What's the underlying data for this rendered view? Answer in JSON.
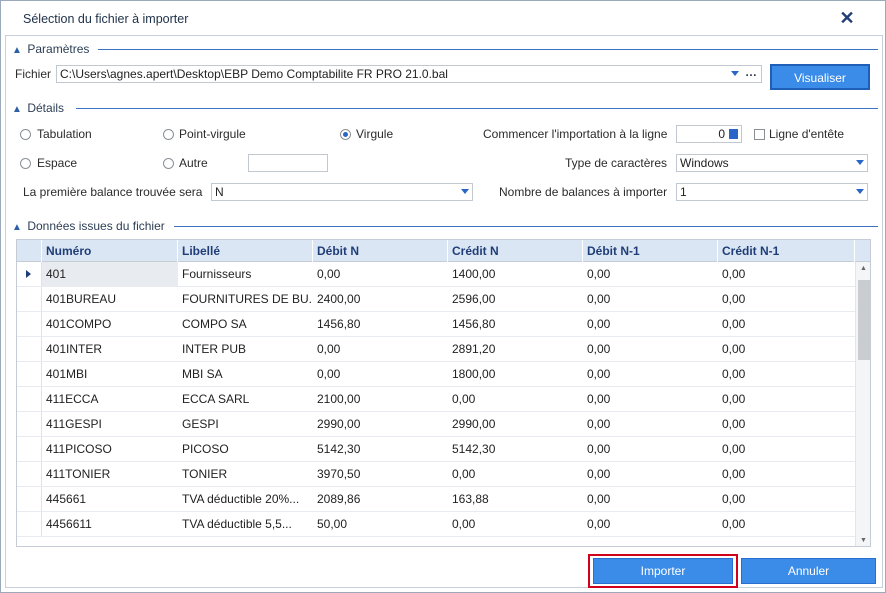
{
  "window": {
    "title": "Sélection du fichier à importer",
    "close_glyph": "✕"
  },
  "parametres": {
    "section_label": "Paramètres",
    "fichier_label": "Fichier",
    "fichier_value": "C:\\Users\\agnes.apert\\Desktop\\EBP Demo Comptabilite FR PRO 21.0.bal",
    "browse_glyph": "…",
    "visualiser_label": "Visualiser"
  },
  "details": {
    "section_label": "Détails",
    "radio_tabulation": "Tabulation",
    "radio_point_virgule": "Point-virgule",
    "radio_virgule": "Virgule",
    "radio_espace": "Espace",
    "radio_autre": "Autre",
    "autre_value": "",
    "selected_separator": "Virgule",
    "commencer_label": "Commencer l'importation à la ligne",
    "commencer_value": "0",
    "ligne_entete_label": "Ligne d'entête",
    "ligne_entete_checked": false,
    "type_caracteres_label": "Type de caractères",
    "type_caracteres_value": "Windows",
    "premiere_balance_label": "La première balance trouvée sera",
    "premiere_balance_value": "N",
    "nombre_balances_label": "Nombre de balances à importer",
    "nombre_balances_value": "1"
  },
  "donnees": {
    "section_label": "Données issues du fichier",
    "columns": [
      "Numéro",
      "Libellé",
      "Débit N",
      "Crédit N",
      "Débit N-1",
      "Crédit N-1"
    ],
    "rows": [
      [
        "401",
        "Fournisseurs",
        "0,00",
        "1400,00",
        "0,00",
        "0,00"
      ],
      [
        "401BUREAU",
        "FOURNITURES DE BU...",
        "2400,00",
        "2596,00",
        "0,00",
        "0,00"
      ],
      [
        "401COMPO",
        "COMPO SA",
        "1456,80",
        "1456,80",
        "0,00",
        "0,00"
      ],
      [
        "401INTER",
        "INTER PUB",
        "0,00",
        "2891,20",
        "0,00",
        "0,00"
      ],
      [
        "401MBI",
        "MBI SA",
        "0,00",
        "1800,00",
        "0,00",
        "0,00"
      ],
      [
        "411ECCA",
        "ECCA SARL",
        "2100,00",
        "0,00",
        "0,00",
        "0,00"
      ],
      [
        "411GESPI",
        "GESPI",
        "2990,00",
        "2990,00",
        "0,00",
        "0,00"
      ],
      [
        "411PICOSO",
        "PICOSO",
        "5142,30",
        "5142,30",
        "0,00",
        "0,00"
      ],
      [
        "411TONIER",
        "TONIER",
        "3970,50",
        "0,00",
        "0,00",
        "0,00"
      ],
      [
        "445661",
        "TVA déductible 20%...",
        "2089,86",
        "163,88",
        "0,00",
        "0,00"
      ],
      [
        "4456611",
        "TVA déductible 5,5...",
        "50,00",
        "0,00",
        "0,00",
        "0,00"
      ]
    ]
  },
  "footer": {
    "importer_label": "Importer",
    "annuler_label": "Annuler"
  },
  "colors": {
    "accent": "#3b8ce8",
    "header_bg": "#dbe6f4",
    "highlight_border": "#d0021b"
  }
}
